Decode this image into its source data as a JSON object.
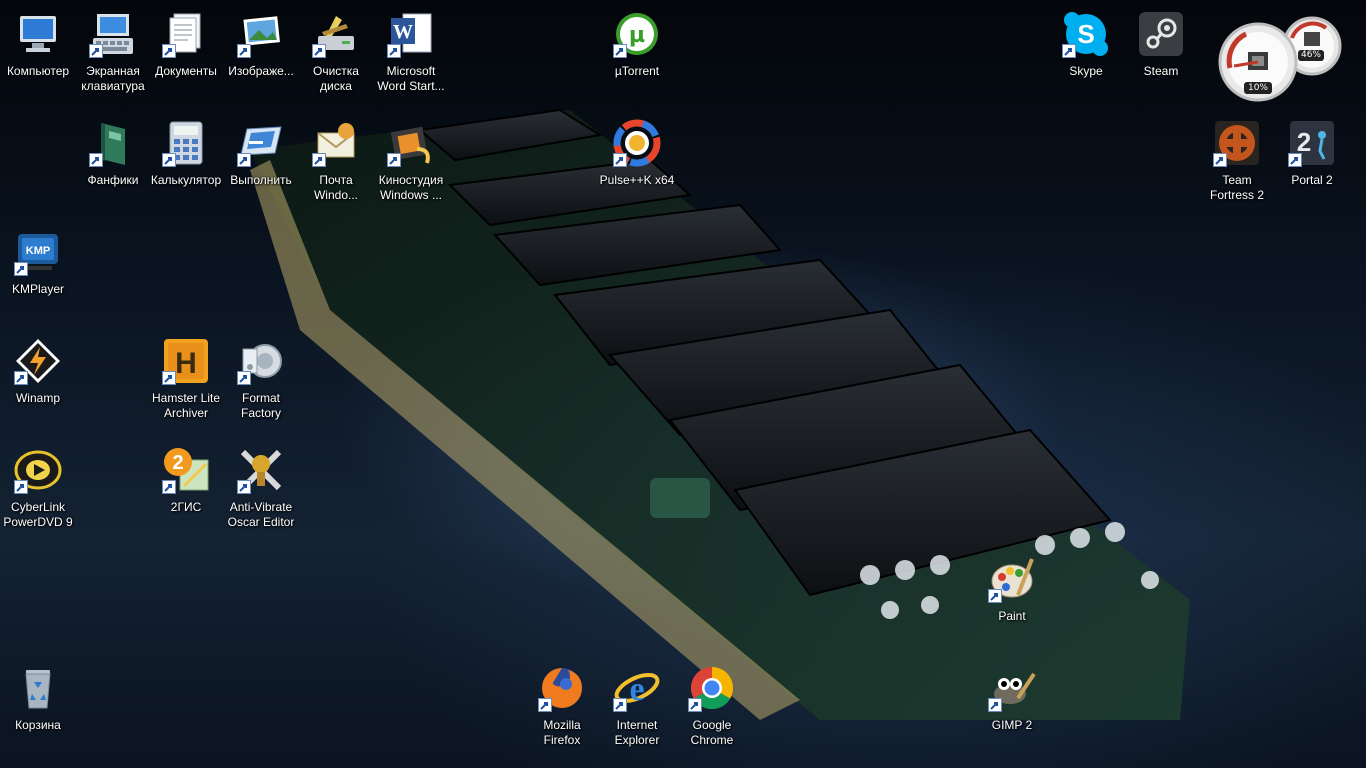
{
  "desktop": {
    "icons": [
      {
        "id": "computer",
        "label": "Компьютер",
        "icon": "computer-icon"
      },
      {
        "id": "osk",
        "label": "Экранная\nклавиатура",
        "icon": "keyboard-icon"
      },
      {
        "id": "documents",
        "label": "Документы",
        "icon": "documents-icon"
      },
      {
        "id": "images",
        "label": "Изображе...",
        "icon": "images-icon"
      },
      {
        "id": "cleanup",
        "label": "Очистка\nдиска",
        "icon": "disk-cleanup-icon"
      },
      {
        "id": "word",
        "label": "Microsoft\nWord Start...",
        "icon": "word-icon"
      },
      {
        "id": "utorrent",
        "label": "µTorrent",
        "icon": "utorrent-icon"
      },
      {
        "id": "skype",
        "label": "Skype",
        "icon": "skype-icon"
      },
      {
        "id": "steam",
        "label": "Steam",
        "icon": "steam-icon"
      },
      {
        "id": "fanfics",
        "label": "Фанфики",
        "icon": "book-icon"
      },
      {
        "id": "calc",
        "label": "Калькулятор",
        "icon": "calculator-icon"
      },
      {
        "id": "run",
        "label": "Выполнить",
        "icon": "run-icon"
      },
      {
        "id": "mail",
        "label": "Почта\nWindo...",
        "icon": "mail-icon"
      },
      {
        "id": "moviemaker",
        "label": "Киностудия\nWindows ...",
        "icon": "film-icon"
      },
      {
        "id": "pulse",
        "label": "Pulse++K x64",
        "icon": "pulse-icon"
      },
      {
        "id": "tf2",
        "label": "Team\nFortress 2",
        "icon": "tf2-icon"
      },
      {
        "id": "portal2",
        "label": "Portal 2",
        "icon": "portal2-icon"
      },
      {
        "id": "kmplayer",
        "label": "KMPlayer",
        "icon": "kmp-icon"
      },
      {
        "id": "winamp",
        "label": "Winamp",
        "icon": "winamp-icon"
      },
      {
        "id": "hamster",
        "label": "Hamster Lite\nArchiver",
        "icon": "hamster-icon"
      },
      {
        "id": "formatfactory",
        "label": "Format\nFactory",
        "icon": "format-factory-icon"
      },
      {
        "id": "powerdvd",
        "label": "CyberLink\nPowerDVD 9",
        "icon": "powerdvd-icon"
      },
      {
        "id": "2gis",
        "label": "2ГИС",
        "icon": "2gis-icon"
      },
      {
        "id": "antivibrate",
        "label": "Anti-Vibrate\nOscar Editor",
        "icon": "oscar-icon"
      },
      {
        "id": "paint",
        "label": "Paint",
        "icon": "paint-icon"
      },
      {
        "id": "recycle",
        "label": "Корзина",
        "icon": "recycle-bin-icon"
      },
      {
        "id": "firefox",
        "label": "Mozilla\nFirefox",
        "icon": "firefox-icon"
      },
      {
        "id": "ie",
        "label": "Internet\nExplorer",
        "icon": "ie-icon"
      },
      {
        "id": "chrome",
        "label": "Google\nChrome",
        "icon": "chrome-icon"
      },
      {
        "id": "gimp",
        "label": "GIMP 2",
        "icon": "gimp-icon"
      }
    ]
  },
  "gadget": {
    "cpu_label": "10%",
    "memory_label": "46%",
    "cpu_percent": 10,
    "memory_percent": 46
  },
  "colors": {
    "gauge_red": "#c0392b",
    "chip_black": "#111418",
    "pcb_green": "#1f3a2e"
  }
}
